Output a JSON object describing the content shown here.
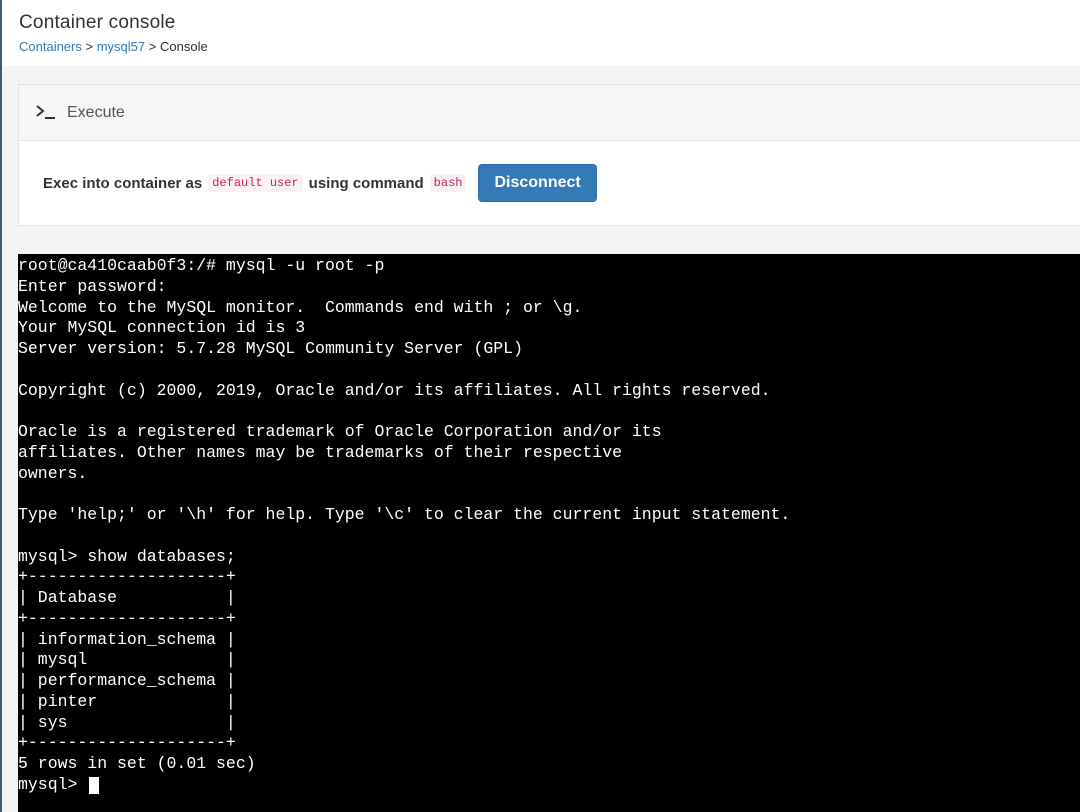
{
  "header": {
    "title": "Container console",
    "breadcrumb": {
      "root": "Containers",
      "container": "mysql57",
      "current": "Console",
      "separator": ">"
    }
  },
  "execute_widget": {
    "title": "Execute",
    "icon": "terminal-icon",
    "text_prefix": "Exec into container as",
    "user_code": "default user",
    "text_middle": "using command",
    "command_code": "bash",
    "disconnect_label": "Disconnect"
  },
  "terminal": {
    "output": "root@ca410caab0f3:/# mysql -u root -p\nEnter password:\nWelcome to the MySQL monitor.  Commands end with ; or \\g.\nYour MySQL connection id is 3\nServer version: 5.7.28 MySQL Community Server (GPL)\n\nCopyright (c) 2000, 2019, Oracle and/or its affiliates. All rights reserved.\n\nOracle is a registered trademark of Oracle Corporation and/or its\naffiliates. Other names may be trademarks of their respective\nowners.\n\nType 'help;' or '\\h' for help. Type '\\c' to clear the current input statement.\n\nmysql> show databases;\n+--------------------+\n| Database           |\n+--------------------+\n| information_schema |\n| mysql              |\n| performance_schema |\n| pinter             |\n| sys                |\n+--------------------+\n5 rows in set (0.01 sec)\n",
    "prompt": "mysql> "
  },
  "colors": {
    "accent": "#337ab7",
    "code_text": "#c7254e",
    "terminal_bg": "#000000",
    "terminal_fg": "#ffffff"
  }
}
